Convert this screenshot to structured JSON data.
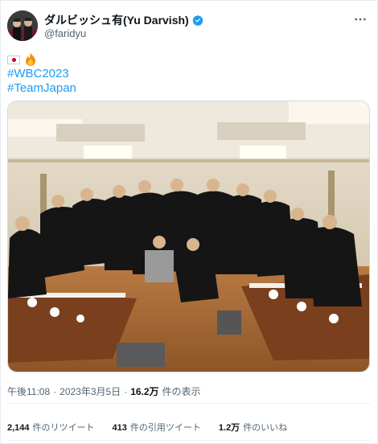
{
  "author": {
    "display_name": "ダルビッシュ有(Yu Darvish)",
    "handle": "@faridyu"
  },
  "tweet": {
    "emoji_icons": [
      "japan-flag",
      "fire"
    ],
    "hashtags": [
      "#WBC2023",
      "#TeamJapan"
    ],
    "photo_icon": "group-photo"
  },
  "meta": {
    "time": "午後11:08",
    "sep1": "·",
    "date": "2023年3月5日",
    "sep2": "·",
    "views_count": "16.2万",
    "views_label": "件の表示"
  },
  "stats": {
    "retweets_count": "2,144",
    "retweets_label": "件のリツイート",
    "quotes_count": "413",
    "quotes_label": "件の引用ツイート",
    "likes_count": "1.2万",
    "likes_label": "件のいいね"
  },
  "colors": {
    "link": "#1d9bf0",
    "verified": "#1d9bf0",
    "secondary_text": "#536471"
  }
}
